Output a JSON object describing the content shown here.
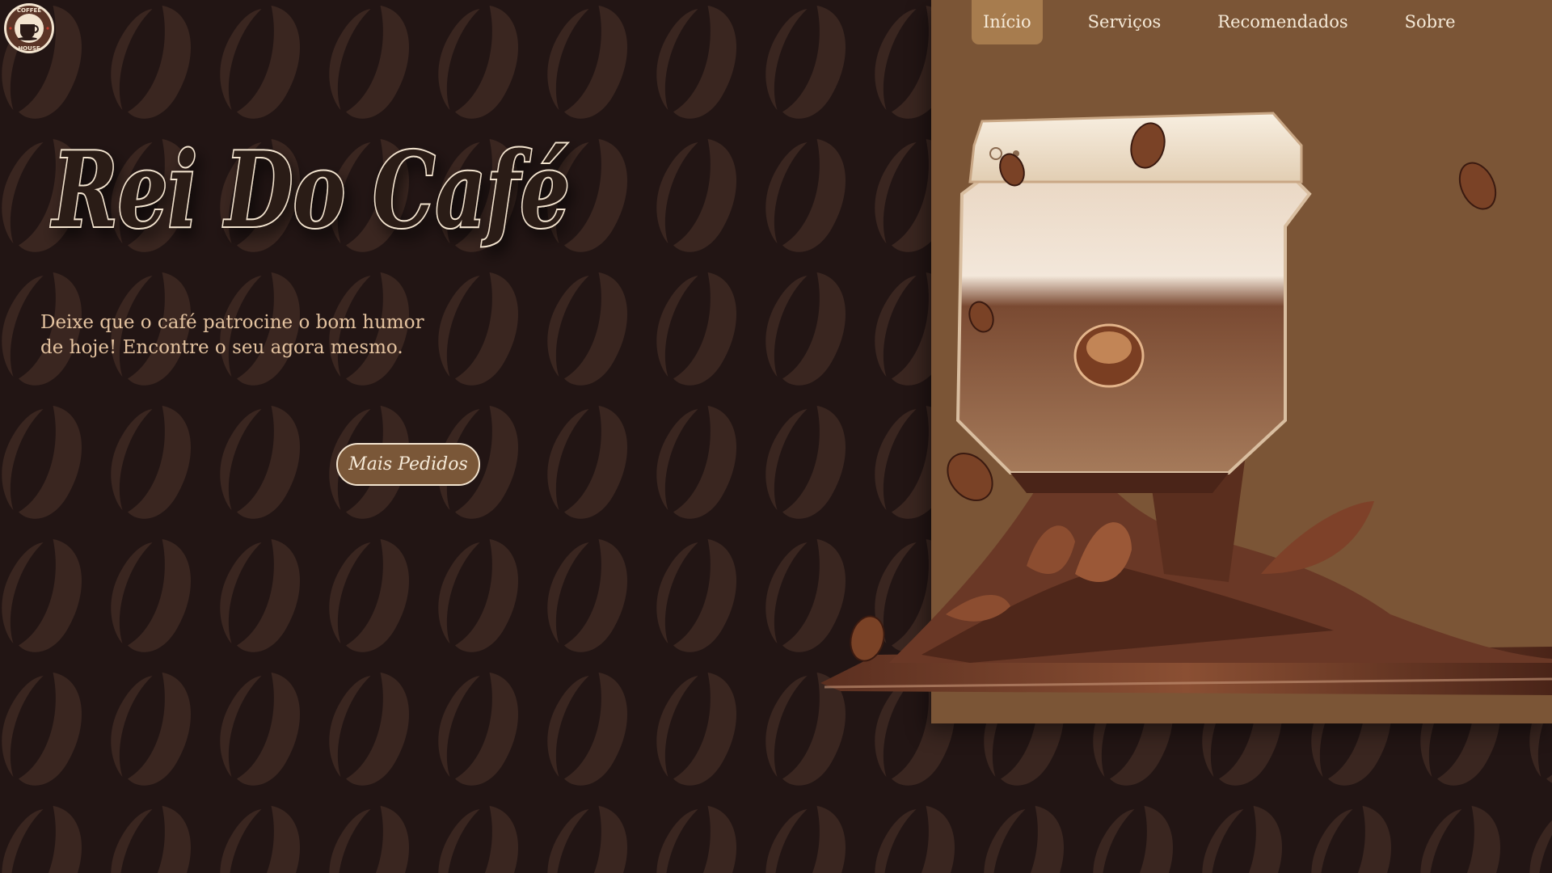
{
  "logo": {
    "top_text": "COFFEE",
    "bottom_text": "HOUSE"
  },
  "nav": {
    "items": [
      {
        "label": "Início",
        "active": true
      },
      {
        "label": "Serviços",
        "active": false
      },
      {
        "label": "Recomendados",
        "active": false
      },
      {
        "label": "Sobre",
        "active": false
      }
    ]
  },
  "hero": {
    "title": "Rei Do Café",
    "tagline_line1": "Deixe que o café patrocine o bom humor",
    "tagline_line2": "de hoje! Encontre o seu agora mesmo.",
    "cta_label": "Mais Pedidos"
  },
  "colors": {
    "background": "#221514",
    "pattern_bean": "#3a2620",
    "panel": "#7b5536",
    "nav_active": "#a77c4e",
    "title_stroke": "#f3e4cf",
    "tagline": "#e3c29f",
    "cta_background": "#7a5738"
  },
  "icons": {
    "logo": "coffee-cup-icon"
  }
}
